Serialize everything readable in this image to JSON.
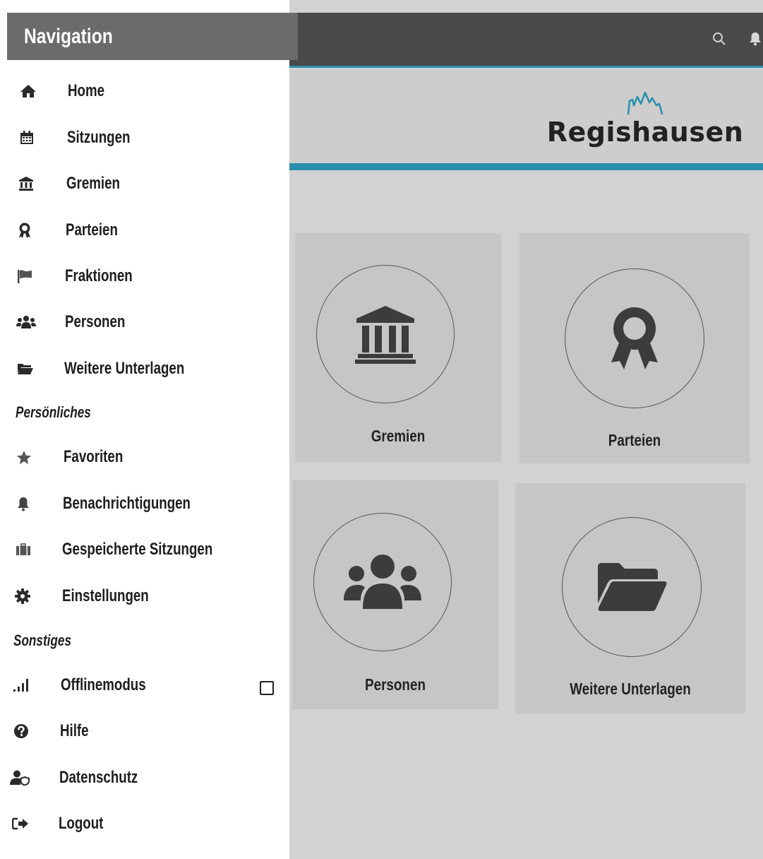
{
  "drawer": {
    "title": "Navigation",
    "items": [
      {
        "label": "Home",
        "icon": "home-icon"
      },
      {
        "label": "Sitzungen",
        "icon": "calendar-icon"
      },
      {
        "label": "Gremien",
        "icon": "institution-icon"
      },
      {
        "label": "Parteien",
        "icon": "award-icon"
      },
      {
        "label": "Fraktionen",
        "icon": "flag-icon"
      },
      {
        "label": "Personen",
        "icon": "users-icon"
      },
      {
        "label": "Weitere Unterlagen",
        "icon": "folder-open-icon"
      }
    ],
    "personal_title": "Persönliches",
    "personal_items": [
      {
        "label": "Favoriten",
        "icon": "star-icon"
      },
      {
        "label": "Benachrichtigungen",
        "icon": "bell-icon"
      },
      {
        "label": "Gespeicherte Sitzungen",
        "icon": "suitcase-icon"
      },
      {
        "label": "Einstellungen",
        "icon": "gear-icon"
      }
    ],
    "other_title": "Sonstiges",
    "other_items": [
      {
        "label": "Offlinemodus",
        "icon": "signal-icon",
        "checked": false
      },
      {
        "label": "Hilfe",
        "icon": "question-icon"
      },
      {
        "label": "Datenschutz",
        "icon": "user-shield-icon"
      },
      {
        "label": "Logout",
        "icon": "sign-out-icon"
      }
    ]
  },
  "header": {
    "icons": [
      "search-icon",
      "bell-icon"
    ]
  },
  "brand": {
    "name": "Regishausen",
    "accent": "#2a8fae"
  },
  "tiles": [
    {
      "label": "Gremien",
      "icon": "institution-icon"
    },
    {
      "label": "Parteien",
      "icon": "award-icon"
    },
    {
      "label": "Personen",
      "icon": "users-icon"
    },
    {
      "label": "Weitere Unterlagen",
      "icon": "folder-open-icon"
    }
  ]
}
